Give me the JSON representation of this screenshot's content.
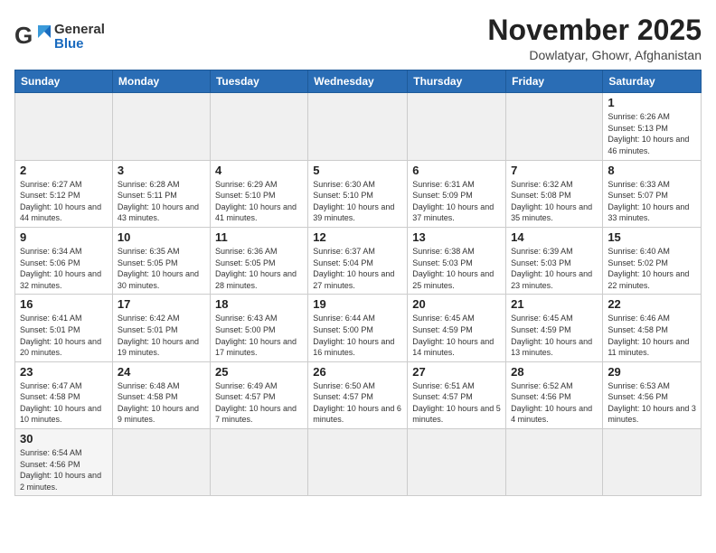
{
  "header": {
    "logo_general": "General",
    "logo_blue": "Blue",
    "title": "November 2025",
    "subtitle": "Dowlatyar, Ghowr, Afghanistan"
  },
  "weekdays": [
    "Sunday",
    "Monday",
    "Tuesday",
    "Wednesday",
    "Thursday",
    "Friday",
    "Saturday"
  ],
  "days": {
    "1": {
      "sunrise": "6:26 AM",
      "sunset": "5:13 PM",
      "daylight": "10 hours and 46 minutes."
    },
    "2": {
      "sunrise": "6:27 AM",
      "sunset": "5:12 PM",
      "daylight": "10 hours and 44 minutes."
    },
    "3": {
      "sunrise": "6:28 AM",
      "sunset": "5:11 PM",
      "daylight": "10 hours and 43 minutes."
    },
    "4": {
      "sunrise": "6:29 AM",
      "sunset": "5:10 PM",
      "daylight": "10 hours and 41 minutes."
    },
    "5": {
      "sunrise": "6:30 AM",
      "sunset": "5:10 PM",
      "daylight": "10 hours and 39 minutes."
    },
    "6": {
      "sunrise": "6:31 AM",
      "sunset": "5:09 PM",
      "daylight": "10 hours and 37 minutes."
    },
    "7": {
      "sunrise": "6:32 AM",
      "sunset": "5:08 PM",
      "daylight": "10 hours and 35 minutes."
    },
    "8": {
      "sunrise": "6:33 AM",
      "sunset": "5:07 PM",
      "daylight": "10 hours and 33 minutes."
    },
    "9": {
      "sunrise": "6:34 AM",
      "sunset": "5:06 PM",
      "daylight": "10 hours and 32 minutes."
    },
    "10": {
      "sunrise": "6:35 AM",
      "sunset": "5:05 PM",
      "daylight": "10 hours and 30 minutes."
    },
    "11": {
      "sunrise": "6:36 AM",
      "sunset": "5:05 PM",
      "daylight": "10 hours and 28 minutes."
    },
    "12": {
      "sunrise": "6:37 AM",
      "sunset": "5:04 PM",
      "daylight": "10 hours and 27 minutes."
    },
    "13": {
      "sunrise": "6:38 AM",
      "sunset": "5:03 PM",
      "daylight": "10 hours and 25 minutes."
    },
    "14": {
      "sunrise": "6:39 AM",
      "sunset": "5:03 PM",
      "daylight": "10 hours and 23 minutes."
    },
    "15": {
      "sunrise": "6:40 AM",
      "sunset": "5:02 PM",
      "daylight": "10 hours and 22 minutes."
    },
    "16": {
      "sunrise": "6:41 AM",
      "sunset": "5:01 PM",
      "daylight": "10 hours and 20 minutes."
    },
    "17": {
      "sunrise": "6:42 AM",
      "sunset": "5:01 PM",
      "daylight": "10 hours and 19 minutes."
    },
    "18": {
      "sunrise": "6:43 AM",
      "sunset": "5:00 PM",
      "daylight": "10 hours and 17 minutes."
    },
    "19": {
      "sunrise": "6:44 AM",
      "sunset": "5:00 PM",
      "daylight": "10 hours and 16 minutes."
    },
    "20": {
      "sunrise": "6:45 AM",
      "sunset": "4:59 PM",
      "daylight": "10 hours and 14 minutes."
    },
    "21": {
      "sunrise": "6:45 AM",
      "sunset": "4:59 PM",
      "daylight": "10 hours and 13 minutes."
    },
    "22": {
      "sunrise": "6:46 AM",
      "sunset": "4:58 PM",
      "daylight": "10 hours and 11 minutes."
    },
    "23": {
      "sunrise": "6:47 AM",
      "sunset": "4:58 PM",
      "daylight": "10 hours and 10 minutes."
    },
    "24": {
      "sunrise": "6:48 AM",
      "sunset": "4:58 PM",
      "daylight": "10 hours and 9 minutes."
    },
    "25": {
      "sunrise": "6:49 AM",
      "sunset": "4:57 PM",
      "daylight": "10 hours and 7 minutes."
    },
    "26": {
      "sunrise": "6:50 AM",
      "sunset": "4:57 PM",
      "daylight": "10 hours and 6 minutes."
    },
    "27": {
      "sunrise": "6:51 AM",
      "sunset": "4:57 PM",
      "daylight": "10 hours and 5 minutes."
    },
    "28": {
      "sunrise": "6:52 AM",
      "sunset": "4:56 PM",
      "daylight": "10 hours and 4 minutes."
    },
    "29": {
      "sunrise": "6:53 AM",
      "sunset": "4:56 PM",
      "daylight": "10 hours and 3 minutes."
    },
    "30": {
      "sunrise": "6:54 AM",
      "sunset": "4:56 PM",
      "daylight": "10 hours and 2 minutes."
    }
  }
}
